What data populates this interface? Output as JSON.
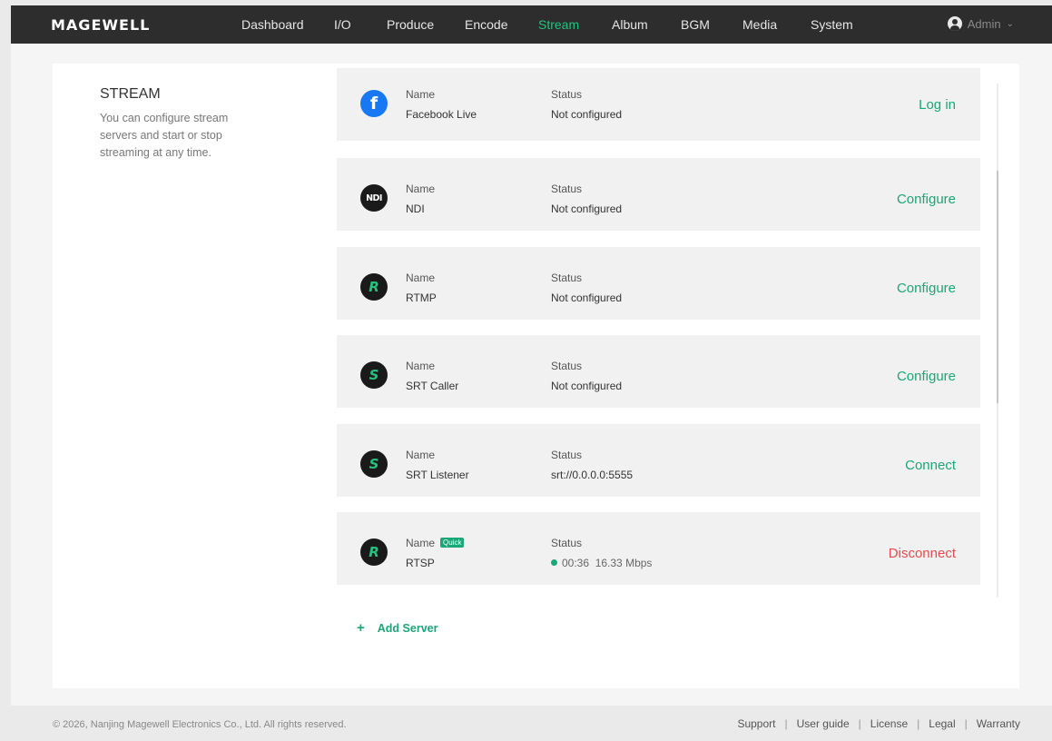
{
  "app": {
    "logo": "MAGEWELL"
  },
  "nav": {
    "items": [
      {
        "label": "Dashboard"
      },
      {
        "label": "I/O"
      },
      {
        "label": "Produce"
      },
      {
        "label": "Encode"
      },
      {
        "label": "Stream",
        "active": true
      },
      {
        "label": "Album"
      },
      {
        "label": "BGM"
      },
      {
        "label": "Media"
      },
      {
        "label": "System"
      }
    ],
    "user": {
      "label": "Admin"
    }
  },
  "sidebar": {
    "title": "STREAM",
    "description": "You can configure stream servers and start or stop streaming at any time."
  },
  "servers": [
    {
      "icon": "facebook-icon",
      "icon_text": "f",
      "name_label": "Name",
      "name": "Facebook Live",
      "status_label": "Status",
      "status": "Not configured",
      "action": "Log in"
    },
    {
      "icon": "ndi-icon",
      "icon_text": "NDI",
      "name_label": "Name",
      "name": "NDI",
      "status_label": "Status",
      "status": "Not configured",
      "action": "Configure"
    },
    {
      "icon": "rtmp-icon",
      "icon_text": "R",
      "name_label": "Name",
      "name": "RTMP",
      "status_label": "Status",
      "status": "Not configured",
      "action": "Configure"
    },
    {
      "icon": "srt-icon",
      "icon_text": "S",
      "name_label": "Name",
      "name": "SRT Caller",
      "status_label": "Status",
      "status": "Not configured",
      "action": "Configure"
    },
    {
      "icon": "srt-icon",
      "icon_text": "S",
      "name_label": "Name",
      "name": "SRT Listener",
      "status_label": "Status",
      "status": "srt://0.0.0.0:5555",
      "action": "Connect"
    },
    {
      "icon": "rtsp-icon",
      "icon_text": "R",
      "name_label": "Name",
      "badge": "Quick",
      "name": "RTSP",
      "status_label": "Status",
      "status_time": "00:36",
      "status_rate": "16.33 Mbps",
      "action": "Disconnect"
    }
  ],
  "add_server": {
    "label": "Add Server"
  },
  "footer": {
    "copyright": "© 2026, Nanjing Magewell Electronics Co., Ltd. All rights reserved.",
    "links": [
      "Support",
      "User guide",
      "License",
      "Legal",
      "Warranty"
    ]
  },
  "colors": {
    "accent": "#1aa676",
    "active_nav": "#25c27f",
    "danger": "#e14b4b",
    "topbar": "#2d2d2d"
  }
}
